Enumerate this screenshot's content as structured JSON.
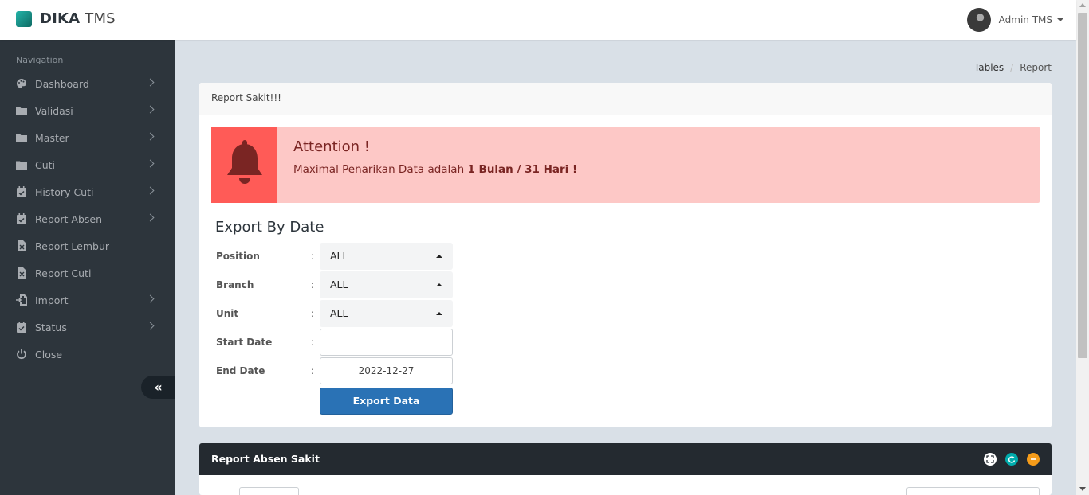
{
  "header": {
    "brand_bold": "DIKA",
    "brand_light": "TMS",
    "user_name": "Admin TMS"
  },
  "sidebar": {
    "nav_header": "Navigation",
    "items": [
      {
        "label": "Dashboard",
        "icon": "palette-icon",
        "has_submenu": true
      },
      {
        "label": "Validasi",
        "icon": "folder-icon",
        "has_submenu": true
      },
      {
        "label": "Master",
        "icon": "folder-icon",
        "has_submenu": true
      },
      {
        "label": "Cuti",
        "icon": "folder-icon",
        "has_submenu": true
      },
      {
        "label": "History Cuti",
        "icon": "calendar-check-icon",
        "has_submenu": true
      },
      {
        "label": "Report Absen",
        "icon": "calendar-check-icon",
        "has_submenu": true
      },
      {
        "label": "Report Lembur",
        "icon": "file-excel-icon",
        "has_submenu": false
      },
      {
        "label": "Report Cuti",
        "icon": "file-excel-icon",
        "has_submenu": false
      },
      {
        "label": "Import",
        "icon": "import-icon",
        "has_submenu": true
      },
      {
        "label": "Status",
        "icon": "calendar-check-icon",
        "has_submenu": true
      },
      {
        "label": "Close",
        "icon": "power-icon",
        "has_submenu": false
      }
    ],
    "collapse_icon": "double-chevron-left-icon"
  },
  "breadcrumb": {
    "items": [
      "Tables",
      "Report"
    ]
  },
  "report_panel": {
    "title": "Report Sakit!!!",
    "alert": {
      "title": "Attention !",
      "text_prefix": "Maximal Penarikan Data adalah ",
      "text_bold": "1 Bulan / 31 Hari !",
      "icon": "bell-icon"
    },
    "export_title": "Export By Date",
    "fields": {
      "position": {
        "label": "Position",
        "value": "ALL"
      },
      "branch": {
        "label": "Branch",
        "value": "ALL"
      },
      "unit": {
        "label": "Unit",
        "value": "ALL"
      },
      "start_date": {
        "label": "Start Date",
        "value": ""
      },
      "end_date": {
        "label": "End Date",
        "value": "2022-12-27"
      }
    },
    "colon": ":",
    "export_button": "Export Data"
  },
  "absen_panel": {
    "title": "Report Absen Sakit"
  },
  "colors": {
    "sidebar_bg": "#2d353c",
    "alert_bg": "#fdc8c6",
    "alert_icon_bg": "#ff5b57",
    "primary_button": "#2a72b5",
    "panel_dark": "#242a30"
  }
}
